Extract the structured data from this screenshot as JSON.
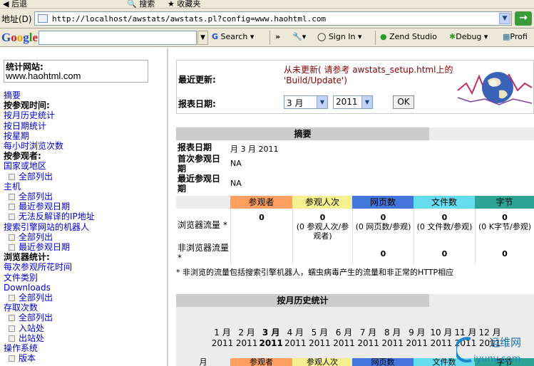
{
  "browser": {
    "toolbar_items": [
      "后退",
      "搜索",
      "收藏夹"
    ],
    "address_label": "地址(D)",
    "url": "http://localhost/awstats/awstats.pl?config=www.haohtml.com",
    "go_label": "→"
  },
  "google_bar": {
    "logo": "Google",
    "search_label": "Search",
    "sign_in_label": "Sign In",
    "zend_label": "Zend Studio",
    "debug_label": "Debug",
    "profile_label": "Profi"
  },
  "sidebar": {
    "site_label": "统计网站:",
    "site_value": "www.haohtml.com",
    "items": [
      {
        "type": "link",
        "label": "摘要"
      },
      {
        "type": "heading",
        "label": "按参观时间:"
      },
      {
        "type": "link",
        "label": "按月历史统计"
      },
      {
        "type": "link",
        "label": "按日期统计"
      },
      {
        "type": "link",
        "label": "按星期"
      },
      {
        "type": "link",
        "label": "每小时浏览次数"
      },
      {
        "type": "heading",
        "label": "按参观者:"
      },
      {
        "type": "link",
        "label": "国家或地区"
      },
      {
        "type": "sub",
        "label": "全部列出"
      },
      {
        "type": "link",
        "label": "主机"
      },
      {
        "type": "sub",
        "label": "全部列出"
      },
      {
        "type": "sub",
        "label": "最近参观日期"
      },
      {
        "type": "sub",
        "label": "无法反解译的IP地址"
      },
      {
        "type": "link",
        "label": "搜索引擎网站的机器人"
      },
      {
        "type": "sub",
        "label": "全部列出"
      },
      {
        "type": "sub",
        "label": "最近参观日期"
      },
      {
        "type": "heading",
        "label": "浏览器统计:"
      },
      {
        "type": "link",
        "label": "每次参观所花时间"
      },
      {
        "type": "link",
        "label": "文件类别"
      },
      {
        "type": "link",
        "label": "Downloads"
      },
      {
        "type": "sub",
        "label": "全部列出"
      },
      {
        "type": "link",
        "label": "存取次数"
      },
      {
        "type": "sub",
        "label": "全部列出"
      },
      {
        "type": "sub",
        "label": "入站处"
      },
      {
        "type": "sub",
        "label": "出站处"
      },
      {
        "type": "link",
        "label": "操作系统"
      },
      {
        "type": "sub",
        "label": "版本"
      }
    ]
  },
  "header": {
    "last_update_label": "最近更新:",
    "last_update_value": "从未更新( 请参考 awstats_setup.html上的 'Build/Update')",
    "report_date_label": "报表日期:",
    "month_value": "3 月",
    "year_value": "2011",
    "ok_label": "OK"
  },
  "summary": {
    "title": "摘要",
    "rows": [
      {
        "label": "报表日期",
        "value": "月 3 月 2011"
      },
      {
        "label": "首次参观日期",
        "value": "NA"
      },
      {
        "label": "最近参观日期",
        "value": "NA"
      }
    ],
    "columns": [
      {
        "label": "参观者",
        "color": "#ffa060"
      },
      {
        "label": "参观人次",
        "color": "#f4f090"
      },
      {
        "label": "网页数",
        "color": "#4477dd"
      },
      {
        "label": "文件数",
        "color": "#66ddee"
      },
      {
        "label": "字节",
        "color": "#2ea495"
      }
    ],
    "traffic_label": "浏览器流量 *",
    "traffic": [
      "0",
      "0",
      "0",
      "0",
      "0"
    ],
    "traffic_sub": [
      "",
      "(0 参观人次/参观者)",
      "(0 网页数/参观)",
      "(0 文件数/参观)",
      "(0 K字节/参观)"
    ],
    "non_browser_label": "非浏览器流量 *",
    "non_browser": [
      "",
      "",
      "0",
      "0",
      "0"
    ],
    "note": "* 非浏览的流量包括搜索引擎机器人，蠕虫病毒产生的流量和非正常的HTTP相应"
  },
  "history": {
    "title": "按月历史统计",
    "months": [
      {
        "m": "1 月",
        "y": "2011",
        "current": false
      },
      {
        "m": "2 月",
        "y": "2011",
        "current": false
      },
      {
        "m": "3 月",
        "y": "2011",
        "current": true
      },
      {
        "m": "4 月",
        "y": "2011",
        "current": false
      },
      {
        "m": "5 月",
        "y": "2011",
        "current": false
      },
      {
        "m": "6 月",
        "y": "2011",
        "current": false
      },
      {
        "m": "7 月",
        "y": "2011",
        "current": false
      },
      {
        "m": "8 月",
        "y": "2011",
        "current": false
      },
      {
        "m": "9 月",
        "y": "2011",
        "current": false
      },
      {
        "m": "10 月",
        "y": "2011",
        "current": false
      },
      {
        "m": "11 月",
        "y": "2011",
        "current": false
      },
      {
        "m": "12 月",
        "y": "2011",
        "current": false
      }
    ],
    "bottom_cols": [
      "月",
      "参观者",
      "参观人次",
      "网页数",
      "文件数",
      "字节"
    ]
  },
  "watermark": {
    "cn": "运维网",
    "en": "iyunv.com"
  }
}
